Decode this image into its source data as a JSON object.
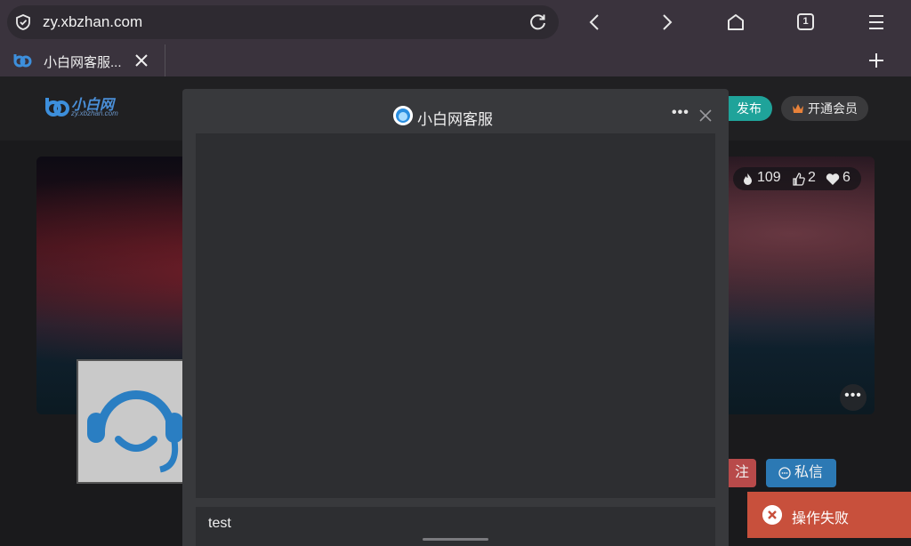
{
  "browser": {
    "url": "zy.xbzhan.com",
    "tab_count": "1",
    "tab_title": "小白网客服...",
    "icons": [
      "shield-icon",
      "reload-icon",
      "back-icon",
      "forward-icon",
      "home-icon",
      "tabs-icon",
      "menu-icon",
      "close-icon",
      "plus-icon"
    ]
  },
  "site": {
    "logo_text": "小白网",
    "logo_sub": "zy.xbzhan.com",
    "publish_label": "发布",
    "vip_label": "开通会员",
    "stats": {
      "views": "109",
      "likes": "2",
      "favorites": "6"
    },
    "follow_label": "注",
    "pm_label": "私信",
    "accent_colors": {
      "publish": "#1fa39a",
      "follow": "#b84a4a",
      "pm": "#2c79b4"
    }
  },
  "modal": {
    "title": "小白网客服",
    "input_value": "test"
  },
  "toast": {
    "text": "操作失败",
    "color": "#c8503c"
  }
}
